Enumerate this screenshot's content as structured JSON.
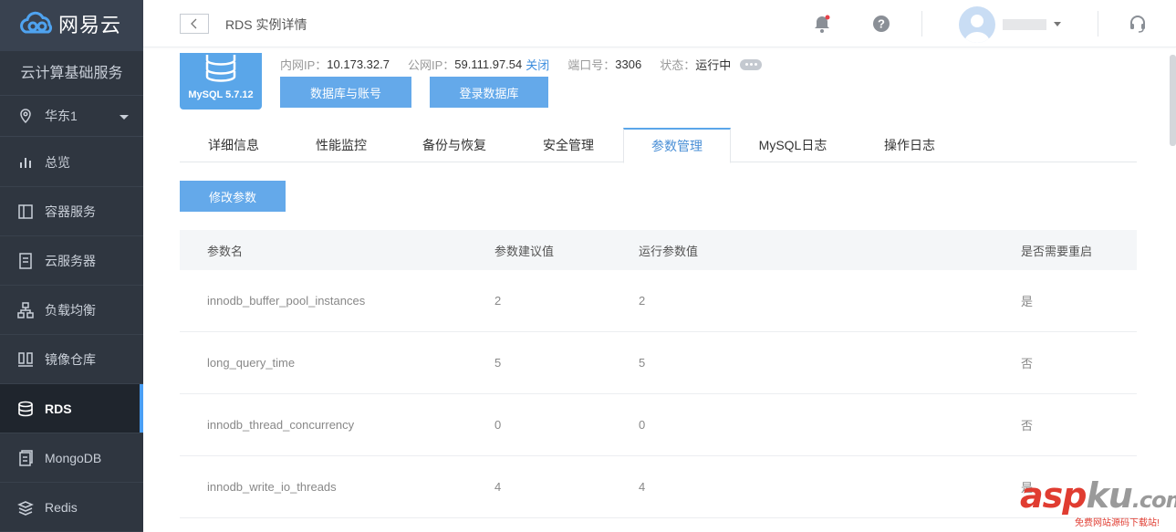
{
  "brand": {
    "name": "网易云"
  },
  "sidebar": {
    "service_title": "云计算基础服务",
    "region": "华东1",
    "items": [
      {
        "label": "总览",
        "icon": "bar-chart-icon",
        "active": false
      },
      {
        "label": "容器服务",
        "icon": "container-icon",
        "active": false
      },
      {
        "label": "云服务器",
        "icon": "server-icon",
        "active": false
      },
      {
        "label": "负载均衡",
        "icon": "load-balancer-icon",
        "active": false
      },
      {
        "label": "镜像仓库",
        "icon": "image-repo-icon",
        "active": false
      },
      {
        "label": "RDS",
        "icon": "database-icon",
        "active": true
      },
      {
        "label": "MongoDB",
        "icon": "mongodb-icon",
        "active": false
      },
      {
        "label": "Redis",
        "icon": "redis-icon",
        "active": false
      }
    ]
  },
  "header": {
    "back_label": "<",
    "title": "RDS 实例详情",
    "notification_dot_color": "#e6424a"
  },
  "instance": {
    "badge": "MySQL 5.7.12",
    "inner_ip_label": "内网IP：",
    "inner_ip": "10.173.32.7",
    "public_ip_label": "公网IP：",
    "public_ip": "59.111.97.54",
    "public_ip_action": "关闭",
    "port_label": "端口号：",
    "port": "3306",
    "status_label": "状态：",
    "status": "运行中",
    "btn_db_accounts": "数据库与账号",
    "btn_login_db": "登录数据库"
  },
  "tabs": [
    {
      "label": "详细信息",
      "active": false
    },
    {
      "label": "性能监控",
      "active": false
    },
    {
      "label": "备份与恢复",
      "active": false
    },
    {
      "label": "安全管理",
      "active": false
    },
    {
      "label": "参数管理",
      "active": true
    },
    {
      "label": "MySQL日志",
      "active": false
    },
    {
      "label": "操作日志",
      "active": false
    }
  ],
  "modify_button": "修改参数",
  "table": {
    "headers": [
      "参数名",
      "参数建议值",
      "运行参数值",
      "是否需要重启"
    ],
    "rows": [
      [
        "innodb_buffer_pool_instances",
        "2",
        "2",
        "是"
      ],
      [
        "long_query_time",
        "5",
        "5",
        "否"
      ],
      [
        "innodb_thread_concurrency",
        "0",
        "0",
        "否"
      ],
      [
        "innodb_write_io_threads",
        "4",
        "4",
        "是"
      ]
    ]
  },
  "watermark": {
    "main_red": "asp",
    "main_gray": "ku",
    "suffix": ".com",
    "sub": "免费网站源码下载站!"
  },
  "colors": {
    "sidebar_bg": "#2f3640",
    "accent": "#5aa6e9",
    "link": "#3c8dde"
  }
}
